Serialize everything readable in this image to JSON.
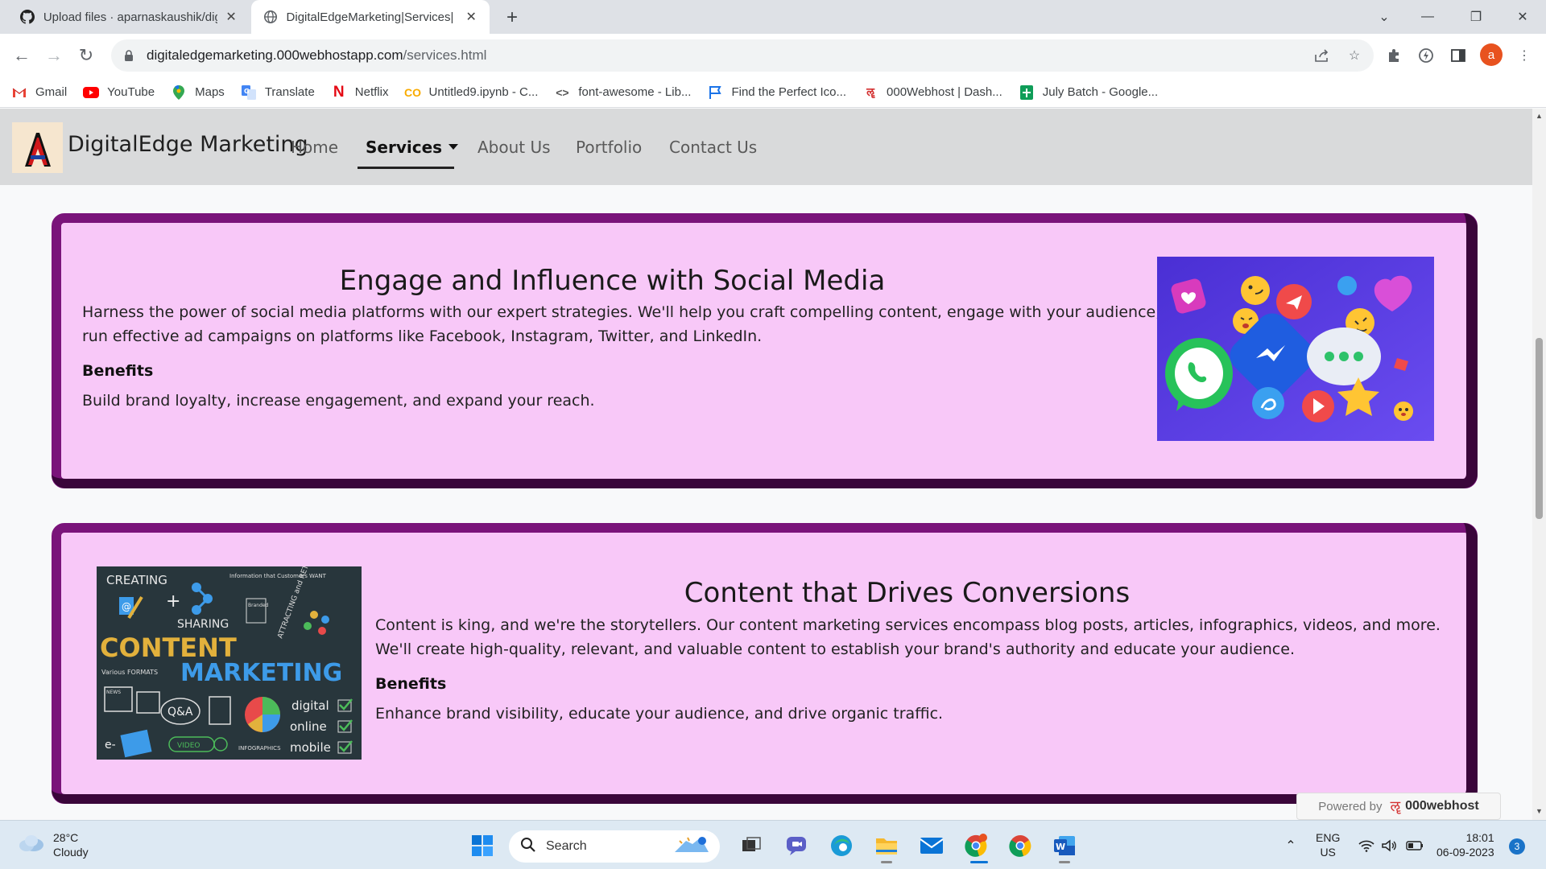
{
  "browser": {
    "tabs": [
      {
        "title": "Upload files · aparnaskaushik/dig"
      },
      {
        "title": "DigitalEdgeMarketing|Services|"
      }
    ],
    "url_domain": "digitaledgemarketing.000webhostapp.com",
    "url_path": "/services.html",
    "profile_initial": "a",
    "bookmarks": [
      {
        "label": "Gmail",
        "icon": "gmail-icon"
      },
      {
        "label": "YouTube",
        "icon": "youtube-icon"
      },
      {
        "label": "Maps",
        "icon": "maps-icon"
      },
      {
        "label": "Translate",
        "icon": "translate-icon"
      },
      {
        "label": "Netflix",
        "icon": "netflix-icon"
      },
      {
        "label": "Untitled9.ipynb - C...",
        "icon": "colab-icon"
      },
      {
        "label": "font-awesome - Lib...",
        "icon": "code-icon"
      },
      {
        "label": "Find the Perfect Ico...",
        "icon": "flag-icon"
      },
      {
        "label": "000Webhost | Dash...",
        "icon": "webhost-icon"
      },
      {
        "label": "July Batch - Google...",
        "icon": "sheets-icon"
      }
    ]
  },
  "site": {
    "brand": "DigitalEdge Marketing",
    "nav": [
      {
        "label": "Home"
      },
      {
        "label": "Services"
      },
      {
        "label": "About Us"
      },
      {
        "label": "Portfolio"
      },
      {
        "label": "Contact Us"
      }
    ],
    "services": [
      {
        "title": "Engage and Influence with Social Media",
        "description": "Harness the power of social media platforms with our expert strategies. We'll help you craft compelling content, engage with your audience, and run effective ad campaigns on platforms like Facebook, Instagram, Twitter, and LinkedIn.",
        "benefits_heading": "Benefits",
        "benefits": "Build brand loyalty, increase engagement, and expand your reach."
      },
      {
        "title": "Content that Drives Conversions",
        "description": "Content is king, and we're the storytellers. Our content marketing services encompass blog posts, articles, infographics, videos, and more. We'll create high-quality, relevant, and valuable content to establish your brand's authority and educate your audience.",
        "benefits_heading": "Benefits",
        "benefits": "Enhance brand visibility, educate your audience, and drive organic traffic."
      }
    ],
    "content_image_text": {
      "creating": "CREATING",
      "sharing": "SHARING",
      "content": "CONTENT",
      "marketing": "MARKETING",
      "info": "Information that Customers WANT",
      "attracting": "ATTRACTING and RETAINING CUSTOMERS",
      "formats": "Various FORMATS",
      "qa": "Q&A",
      "video": "VIDEO",
      "infographics": "INFOGRAPHICS",
      "digital": "digital",
      "online": "online",
      "mobile": "mobile",
      "news": "NEWS",
      "ebook": "e-",
      "branded": "Branded"
    },
    "powered_by": "Powered by",
    "powered_brand": "000webhost"
  },
  "taskbar": {
    "temperature": "28°C",
    "condition": "Cloudy",
    "search_placeholder": "Search",
    "lang1": "ENG",
    "lang2": "US",
    "time": "18:01",
    "date": "06-09-2023",
    "notifications": "3"
  }
}
